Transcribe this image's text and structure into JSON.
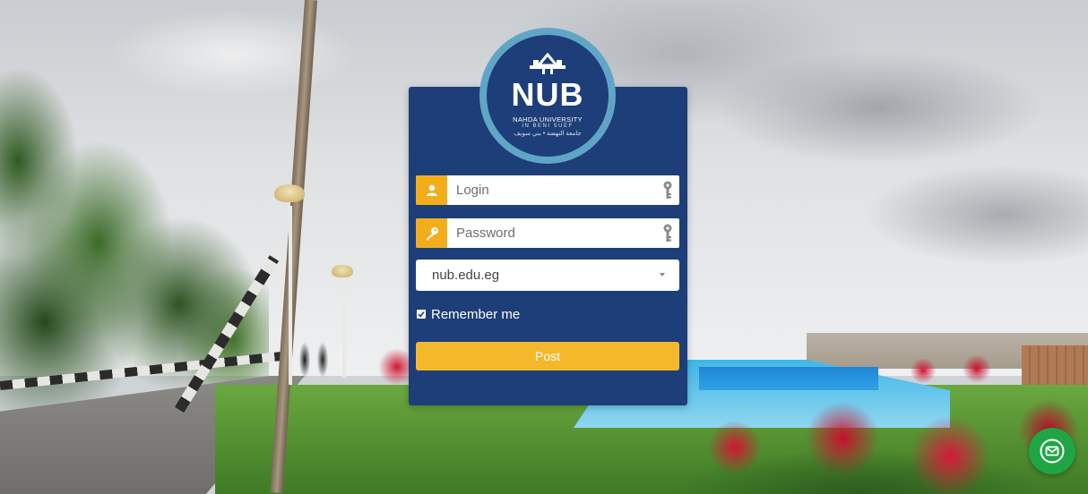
{
  "logo": {
    "wordmark": "NUB",
    "line1": "NAHDA UNIVERSITY",
    "line2": "IN BENI SUEF",
    "line3": "جامعة النهضة • بني سويف"
  },
  "form": {
    "login_placeholder": "Login",
    "password_placeholder": "Password",
    "domain_selected": "nub.edu.eg",
    "remember_label": "Remember me",
    "remember_checked": true,
    "submit_label": "Post"
  },
  "icons": {
    "login_addon": "user-icon",
    "password_addon": "key-icon",
    "field_hint": "keyhole-icon",
    "chat": "envelope-icon"
  },
  "colors": {
    "panel": "#1d3e78",
    "accent": "#f2ae1a",
    "button": "#f5b82a",
    "ring": "#5fa6c6",
    "chat": "#20a544"
  }
}
